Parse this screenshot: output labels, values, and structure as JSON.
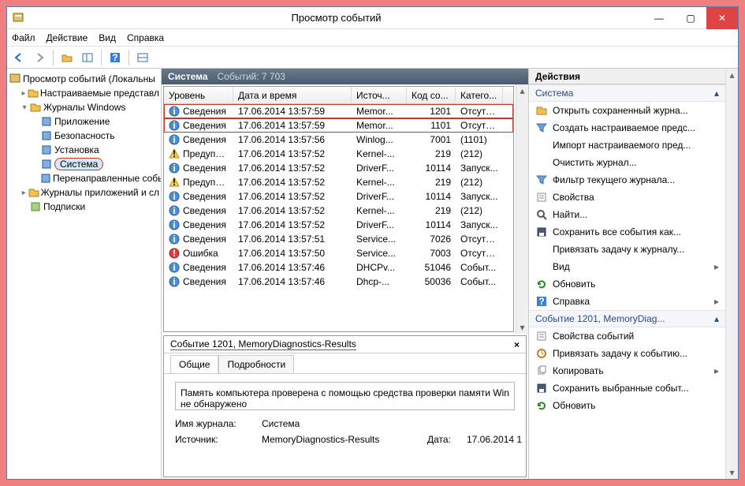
{
  "window": {
    "title": "Просмотр событий"
  },
  "menu": [
    "Файл",
    "Действие",
    "Вид",
    "Справка"
  ],
  "tree": {
    "root": "Просмотр событий (Локальны",
    "custom": "Настраиваемые представл",
    "winlogs": "Журналы Windows",
    "winlogs_items": [
      "Приложение",
      "Безопасность",
      "Установка",
      "Система",
      "Перенаправленные собы"
    ],
    "applogs": "Журналы приложений и сл",
    "subs": "Подписки"
  },
  "center": {
    "header_title": "Система",
    "header_count": "Событий: 7 703",
    "cols": [
      "Уровень",
      "Дата и время",
      "Источ...",
      "Код со...",
      "Катего..."
    ],
    "events": [
      {
        "icon": "info",
        "level": "Сведения",
        "date": "17.06.2014 13:57:59",
        "src": "Memor...",
        "code": "1201",
        "cat": "Отсутс...",
        "hl": true
      },
      {
        "icon": "info",
        "level": "Сведения",
        "date": "17.06.2014 13:57:59",
        "src": "Memor...",
        "code": "1101",
        "cat": "Отсутс...",
        "hl": true
      },
      {
        "icon": "info",
        "level": "Сведения",
        "date": "17.06.2014 13:57:56",
        "src": "Winlog...",
        "code": "7001",
        "cat": "(1101)"
      },
      {
        "icon": "warn",
        "level": "Предупреж...",
        "date": "17.06.2014 13:57:52",
        "src": "Kernel-...",
        "code": "219",
        "cat": "(212)"
      },
      {
        "icon": "info",
        "level": "Сведения",
        "date": "17.06.2014 13:57:52",
        "src": "DriverF...",
        "code": "10114",
        "cat": "Запуск..."
      },
      {
        "icon": "warn",
        "level": "Предупреж...",
        "date": "17.06.2014 13:57:52",
        "src": "Kernel-...",
        "code": "219",
        "cat": "(212)"
      },
      {
        "icon": "info",
        "level": "Сведения",
        "date": "17.06.2014 13:57:52",
        "src": "DriverF...",
        "code": "10114",
        "cat": "Запуск..."
      },
      {
        "icon": "info",
        "level": "Сведения",
        "date": "17.06.2014 13:57:52",
        "src": "Kernel-...",
        "code": "219",
        "cat": "(212)"
      },
      {
        "icon": "info",
        "level": "Сведения",
        "date": "17.06.2014 13:57:52",
        "src": "DriverF...",
        "code": "10114",
        "cat": "Запуск..."
      },
      {
        "icon": "info",
        "level": "Сведения",
        "date": "17.06.2014 13:57:51",
        "src": "Service...",
        "code": "7026",
        "cat": "Отсутс..."
      },
      {
        "icon": "error",
        "level": "Ошибка",
        "date": "17.06.2014 13:57:50",
        "src": "Service...",
        "code": "7003",
        "cat": "Отсутс..."
      },
      {
        "icon": "info",
        "level": "Сведения",
        "date": "17.06.2014 13:57:46",
        "src": "DHCPv...",
        "code": "51046",
        "cat": "Событ..."
      },
      {
        "icon": "info",
        "level": "Сведения",
        "date": "17.06.2014 13:57:46",
        "src": "Dhcp-...",
        "code": "50036",
        "cat": "Событ..."
      }
    ]
  },
  "details": {
    "title": "Событие 1201, MemoryDiagnostics-Results",
    "tabs": [
      "Общие",
      "Подробности"
    ],
    "message": "Память компьютера проверена с помощью средства проверки памяти Win не обнаружено",
    "fields": {
      "logname_lbl": "Имя журнала:",
      "logname": "Система",
      "source_lbl": "Источник:",
      "source": "MemoryDiagnostics-Results",
      "date_lbl": "Дата:",
      "date": "17.06.2014 1"
    }
  },
  "actions": {
    "title": "Действия",
    "section1": "Система",
    "items1": [
      {
        "icon": "open",
        "label": "Открыть сохраненный журна..."
      },
      {
        "icon": "filter",
        "label": "Создать настраиваемое предс..."
      },
      {
        "icon": "none",
        "label": "Импорт настраиваемого пред..."
      },
      {
        "icon": "none",
        "label": "Очистить журнал..."
      },
      {
        "icon": "filter",
        "label": "Фильтр текущего журнала..."
      },
      {
        "icon": "props",
        "label": "Свойства"
      },
      {
        "icon": "find",
        "label": "Найти..."
      },
      {
        "icon": "save",
        "label": "Сохранить все события как..."
      },
      {
        "icon": "none",
        "label": "Привязать задачу к журналу..."
      },
      {
        "icon": "none",
        "label": "Вид",
        "arrow": true
      },
      {
        "icon": "refresh",
        "label": "Обновить"
      },
      {
        "icon": "help",
        "label": "Справка",
        "arrow": true
      }
    ],
    "section2": "Событие 1201, MemoryDiag...",
    "items2": [
      {
        "icon": "props",
        "label": "Свойства событий"
      },
      {
        "icon": "task",
        "label": "Привязать задачу к событию..."
      },
      {
        "icon": "copy",
        "label": "Копировать",
        "arrow": true
      },
      {
        "icon": "save",
        "label": "Сохранить выбранные событ..."
      },
      {
        "icon": "refresh",
        "label": "Обновить"
      }
    ]
  }
}
